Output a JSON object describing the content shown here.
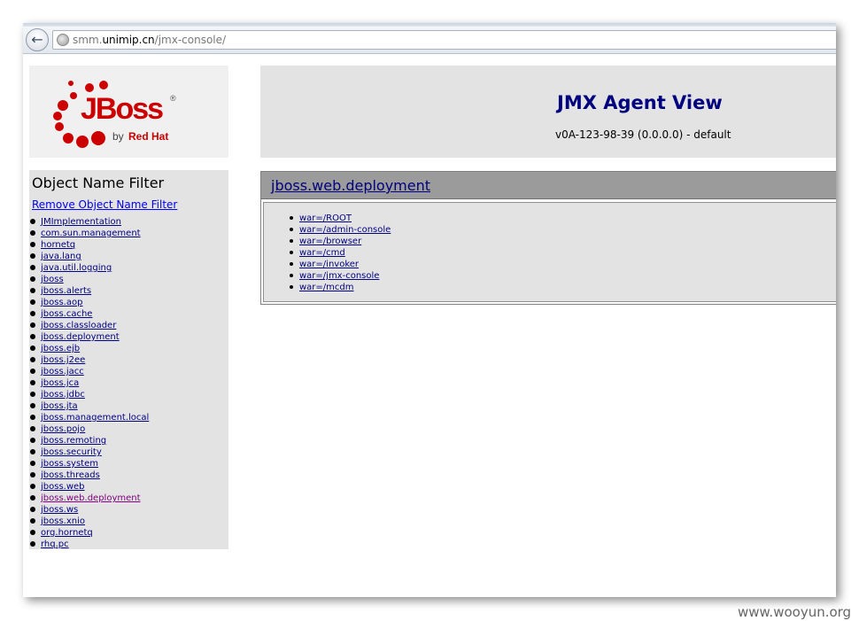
{
  "browser": {
    "url_prefix": "smm.",
    "url_host": "unimip.cn",
    "url_path": "/jmx-console/"
  },
  "logo": {
    "brand": "JBoss",
    "registered": "®",
    "by_label": "by",
    "company": "Red Hat",
    "brand_color": "#cc0000"
  },
  "header": {
    "title": "JMX Agent View",
    "subtitle": "v0A-123-98-39 (0.0.0.0) - default"
  },
  "filter": {
    "title": "Object Name Filter",
    "remove_link": "Remove Object Name Filter",
    "domains": [
      "JMImplementation",
      "com.sun.management",
      "hornetq",
      "java.lang",
      "java.util.logging",
      "jboss",
      "jboss.alerts",
      "jboss.aop",
      "jboss.cache",
      "jboss.classloader",
      "jboss.deployment",
      "jboss.ejb",
      "jboss.j2ee",
      "jboss.jacc",
      "jboss.jca",
      "jboss.jdbc",
      "jboss.jta",
      "jboss.management.local",
      "jboss.pojo",
      "jboss.remoting",
      "jboss.security",
      "jboss.system",
      "jboss.threads",
      "jboss.web",
      "jboss.web.deployment",
      "jboss.ws",
      "jboss.xnio",
      "org.hornetq",
      "rhq.pc"
    ],
    "visited_index": 24
  },
  "mbean": {
    "domain_title": "jboss.web.deployment",
    "items": [
      "war=/ROOT",
      "war=/admin-console",
      "war=/browser",
      "war=/cmd",
      "war=/invoker",
      "war=/jmx-console",
      "war=/mcdm"
    ]
  },
  "watermark": "www.wooyun.org"
}
